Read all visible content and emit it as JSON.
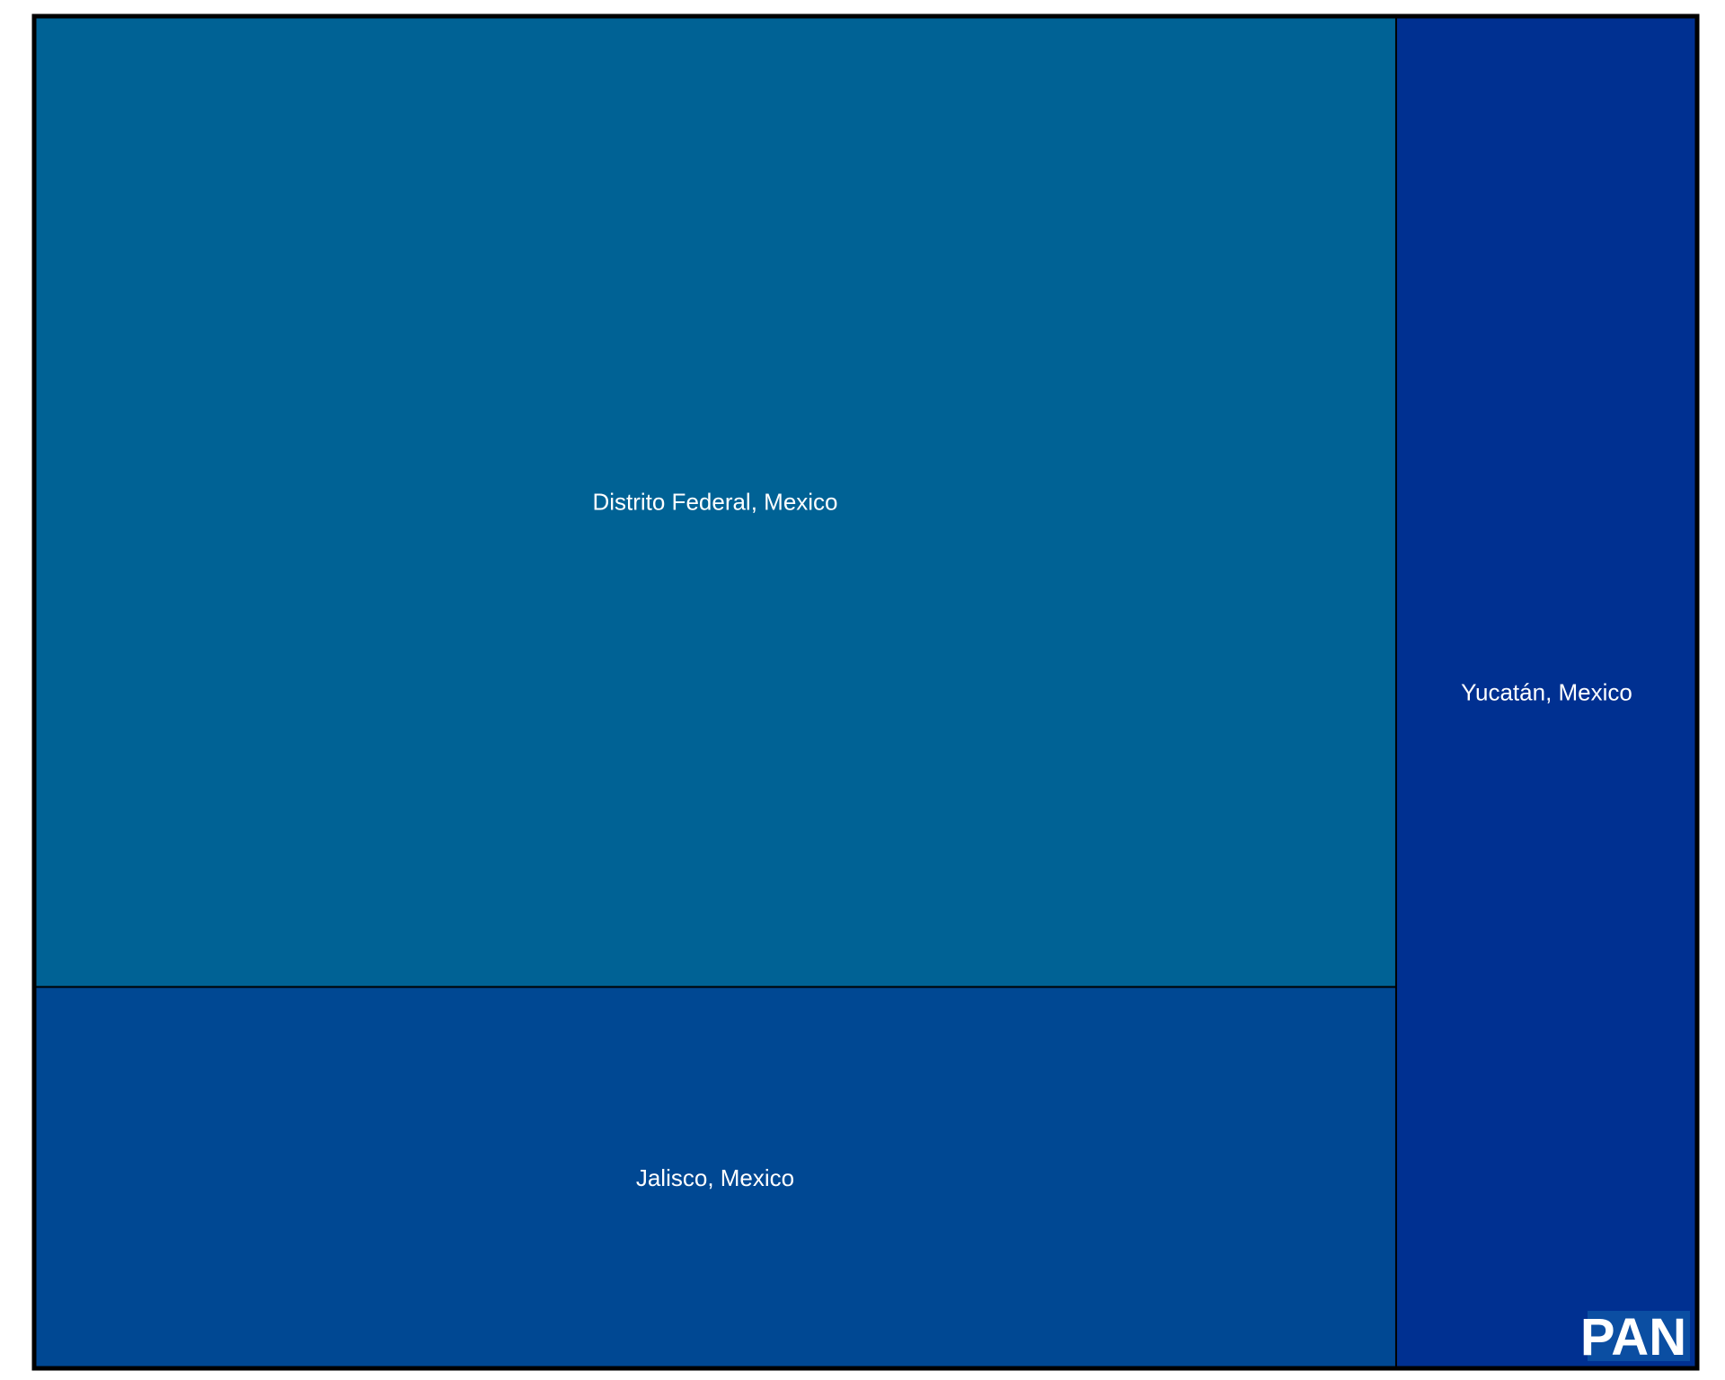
{
  "chart_data": {
    "type": "treemap",
    "nodes": [
      {
        "name": "Distrito Federal, Mexico",
        "value": 58.8,
        "color": "#006295"
      },
      {
        "name": "Jalisco, Mexico",
        "value": 23.1,
        "color": "#004893"
      },
      {
        "name": "Yucatán, Mexico",
        "value": 18.1,
        "color": "#003091"
      }
    ],
    "border_color": "#000000",
    "legend_badge": {
      "text": "PAN",
      "color": "#0b4ea2"
    }
  }
}
